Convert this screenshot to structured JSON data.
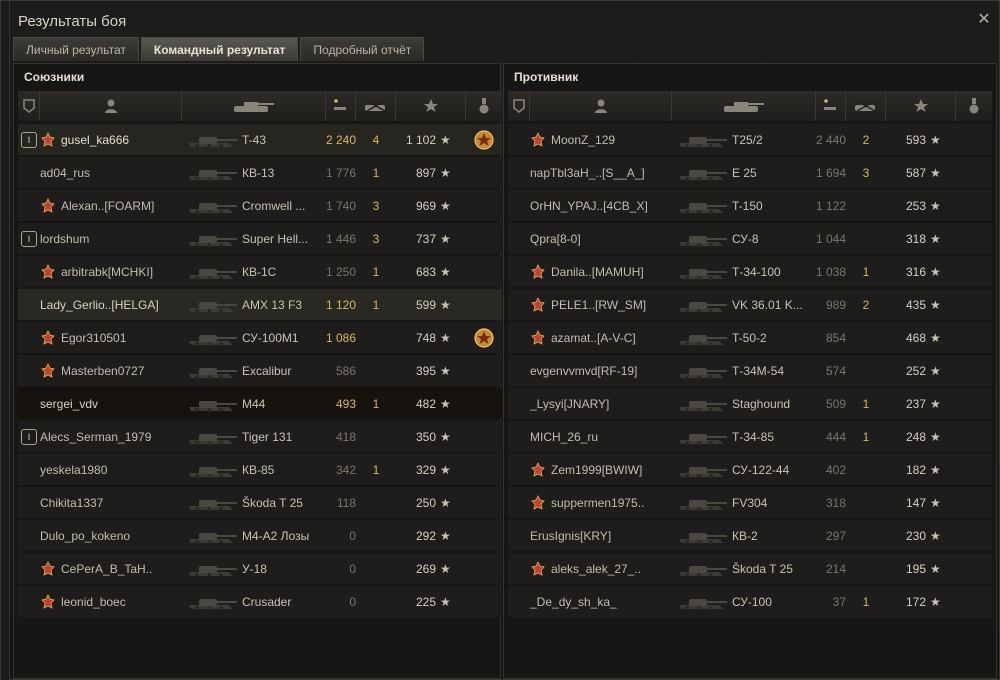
{
  "window": {
    "title": "Результаты боя",
    "close_icon": "close-icon"
  },
  "tabs": [
    {
      "label": "Личный результат",
      "active": false
    },
    {
      "label": "Командный результат",
      "active": true
    },
    {
      "label": "Подробный отчёт",
      "active": false
    }
  ],
  "allies": {
    "title": "Союзники",
    "rows": [
      {
        "player": "gusel_ka666",
        "tank": "T-43",
        "damage": "2 240",
        "kills": "4",
        "xp": "1 102",
        "platoon": "I",
        "clan": true,
        "medal": "2",
        "style": "self",
        "dmg_hi": true
      },
      {
        "player": "ad04_rus",
        "tank": "КВ-13",
        "damage": "1 776",
        "kills": "1",
        "xp": "897",
        "platoon": "",
        "clan": false,
        "medal": "",
        "style": "",
        "dmg_hi": false
      },
      {
        "player": "Alexan..[FOARM]",
        "tank": "Cromwell ...",
        "damage": "1 740",
        "kills": "3",
        "xp": "969",
        "platoon": "",
        "clan": true,
        "medal": "",
        "style": "",
        "dmg_hi": false
      },
      {
        "player": "lordshum",
        "tank": "Super Hell...",
        "damage": "1 446",
        "kills": "3",
        "xp": "737",
        "platoon": "I",
        "clan": false,
        "medal": "",
        "style": "",
        "dmg_hi": false
      },
      {
        "player": "arbitrabk[MCHKI]",
        "tank": "КВ-1С",
        "damage": "1 250",
        "kills": "1",
        "xp": "683",
        "platoon": "",
        "clan": true,
        "medal": "",
        "style": "",
        "dmg_hi": false
      },
      {
        "player": "Lady_Gerlio..[HELGA]",
        "tank": "AMX 13 F3",
        "damage": "1 120",
        "kills": "1",
        "xp": "599",
        "platoon": "",
        "clan": false,
        "medal": "",
        "style": "highlight",
        "dmg_hi": true
      },
      {
        "player": "Egor310501",
        "tank": "СУ-100М1",
        "damage": "1 086",
        "kills": "",
        "xp": "748",
        "platoon": "",
        "clan": true,
        "medal": "1",
        "style": "",
        "dmg_hi": true
      },
      {
        "player": "Masterben0727",
        "tank": "Excalibur",
        "damage": "586",
        "kills": "",
        "xp": "395",
        "platoon": "",
        "clan": true,
        "medal": "",
        "style": "",
        "dmg_hi": false
      },
      {
        "player": "sergei_vdv",
        "tank": "M44",
        "damage": "493",
        "kills": "1",
        "xp": "482",
        "platoon": "",
        "clan": false,
        "medal": "",
        "style": "plain",
        "dmg_hi": true
      },
      {
        "player": "Alecs_Serman_1979",
        "tank": "Tiger 131",
        "damage": "418",
        "kills": "",
        "xp": "350",
        "platoon": "I",
        "clan": false,
        "medal": "",
        "style": "",
        "dmg_hi": false
      },
      {
        "player": "yeskela1980",
        "tank": "КВ-85",
        "damage": "342",
        "kills": "1",
        "xp": "329",
        "platoon": "",
        "clan": false,
        "medal": "",
        "style": "",
        "dmg_hi": false
      },
      {
        "player": "Chikita1337",
        "tank": "Škoda T 25",
        "damage": "118",
        "kills": "",
        "xp": "250",
        "platoon": "",
        "clan": false,
        "medal": "",
        "style": "",
        "dmg_hi": false
      },
      {
        "player": "Dulo_po_kokeno",
        "tank": "М4-А2 Лозы",
        "damage": "0",
        "kills": "",
        "xp": "292",
        "platoon": "",
        "clan": false,
        "medal": "",
        "style": "",
        "dmg_hi": false
      },
      {
        "player": "CePerA_B_TaH..",
        "tank": "У-18",
        "damage": "0",
        "kills": "",
        "xp": "269",
        "platoon": "",
        "clan": true,
        "medal": "",
        "style": "",
        "dmg_hi": false
      },
      {
        "player": "leonid_boec",
        "tank": "Crusader",
        "damage": "0",
        "kills": "",
        "xp": "225",
        "platoon": "",
        "clan": true,
        "medal": "",
        "style": "",
        "dmg_hi": false
      }
    ]
  },
  "enemies": {
    "title": "Противник",
    "rows": [
      {
        "player": "MoonZ_129",
        "tank": "T25/2",
        "damage": "2 440",
        "kills": "2",
        "xp": "593",
        "clan": true
      },
      {
        "player": "napTbl3aH_..[S__A_]",
        "tank": "E 25",
        "damage": "1 694",
        "kills": "3",
        "xp": "587",
        "clan": false
      },
      {
        "player": "OrHN_YPAJ..[4CB_X]",
        "tank": "T-150",
        "damage": "1 122",
        "kills": "",
        "xp": "253",
        "clan": false
      },
      {
        "player": "Qpra[8-0]",
        "tank": "СУ-8",
        "damage": "1 044",
        "kills": "",
        "xp": "318",
        "clan": false
      },
      {
        "player": "Danila..[MAMUH]",
        "tank": "Т-34-100",
        "damage": "1 038",
        "kills": "1",
        "xp": "316",
        "clan": true
      },
      {
        "player": "PELE1..[RW_SM]",
        "tank": "VK 36.01 K...",
        "damage": "989",
        "kills": "2",
        "xp": "435",
        "clan": true
      },
      {
        "player": "azamat..[A-V-C]",
        "tank": "T-50-2",
        "damage": "854",
        "kills": "",
        "xp": "468",
        "clan": true
      },
      {
        "player": "evgenvvmvd[RF-19]",
        "tank": "Т-34М-54",
        "damage": "574",
        "kills": "",
        "xp": "252",
        "clan": false
      },
      {
        "player": "_Lysyi[JNARY]",
        "tank": "Staghound",
        "damage": "509",
        "kills": "1",
        "xp": "237",
        "clan": false
      },
      {
        "player": "MICH_26_ru",
        "tank": "Т-34-85",
        "damage": "444",
        "kills": "1",
        "xp": "248",
        "clan": false
      },
      {
        "player": "Zem1999[BWIW]",
        "tank": "СУ-122-44",
        "damage": "402",
        "kills": "",
        "xp": "182",
        "clan": true
      },
      {
        "player": "suppermen1975..",
        "tank": "FV304",
        "damage": "318",
        "kills": "",
        "xp": "147",
        "clan": true
      },
      {
        "player": "ErusIgnis[KRY]",
        "tank": "КВ-2",
        "damage": "297",
        "kills": "",
        "xp": "230",
        "clan": false
      },
      {
        "player": "aleks_alek_27_..",
        "tank": "Škoda T 25",
        "damage": "214",
        "kills": "",
        "xp": "195",
        "clan": true
      },
      {
        "player": "_De_dy_sh_ka_",
        "tank": "СУ-100",
        "damage": "37",
        "kills": "1",
        "xp": "172",
        "clan": false
      }
    ]
  },
  "icons": {
    "star": "★",
    "columns": [
      "rank-icon",
      "player-icon",
      "tank-icon",
      "damage-icon",
      "kills-icon",
      "xp-star-icon",
      "medal-icon"
    ]
  },
  "colors": {
    "accent": "#d7b660",
    "text": "#cfc8b8",
    "background": "#161615"
  }
}
